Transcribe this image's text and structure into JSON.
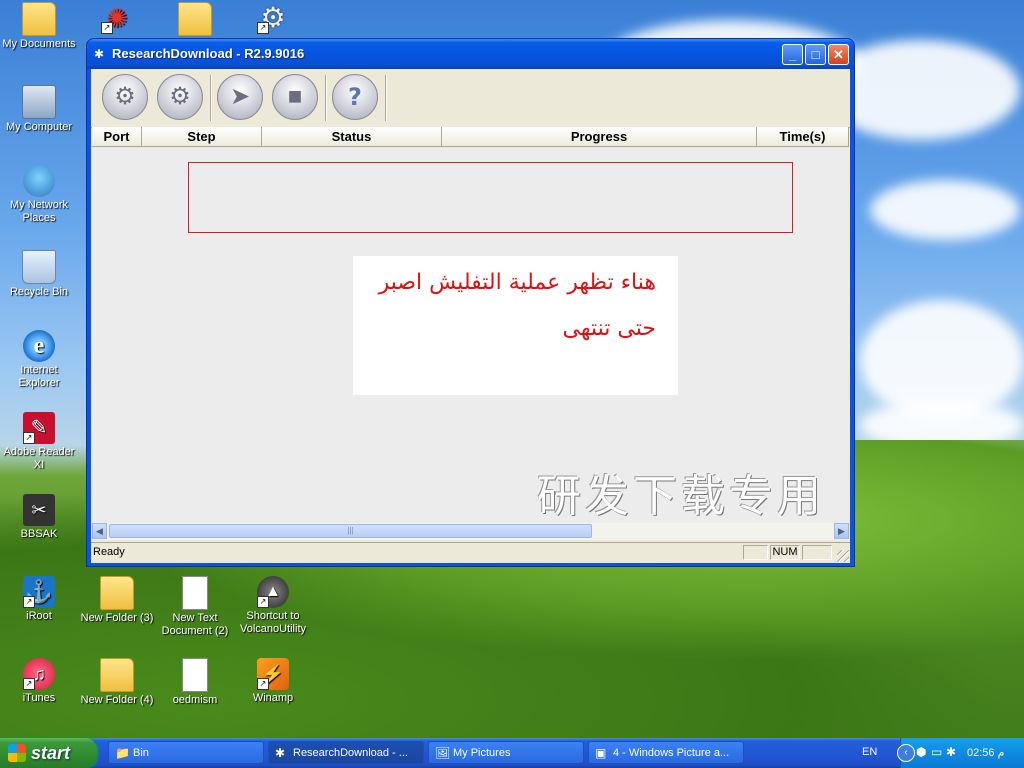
{
  "desktop": {
    "icons": [
      {
        "label": "My Documents"
      },
      {
        "label": "My Computer"
      },
      {
        "label": "My Network Places"
      },
      {
        "label": "Recycle Bin"
      },
      {
        "label": "Internet Explorer"
      },
      {
        "label": "Adobe Reader XI"
      },
      {
        "label": "BBSAK"
      },
      {
        "label": "iRoot"
      },
      {
        "label": "iTunes"
      },
      {
        "label": "New Folder (3)"
      },
      {
        "label": "New Folder (4)"
      },
      {
        "label": "New Text Document (2)"
      },
      {
        "label": "oedmism"
      },
      {
        "label": "Shortcut to VolcanoUtility"
      },
      {
        "label": "Winamp"
      }
    ]
  },
  "window": {
    "title": "ResearchDownload - R2.9.9016",
    "columns": [
      "Port",
      "Step",
      "Status",
      "Progress",
      "Time(s)"
    ],
    "note_line1": "هناء تظهر عملية التفليش اصبر",
    "note_line2": "حتى تنتهى",
    "watermark": "研发下载专用",
    "status": "Ready",
    "status_num": "NUM"
  },
  "taskbar": {
    "start_label": "start",
    "tasks": [
      {
        "label": "Bin"
      },
      {
        "label": "ResearchDownload - ..."
      },
      {
        "label": "My Pictures"
      },
      {
        "label": "4 - Windows Picture a..."
      }
    ],
    "language": "EN",
    "clock": "02:56 م"
  },
  "colors": {
    "titlebar": "#0554e0",
    "note_text": "#e01010",
    "redbox_border": "#d02020"
  }
}
